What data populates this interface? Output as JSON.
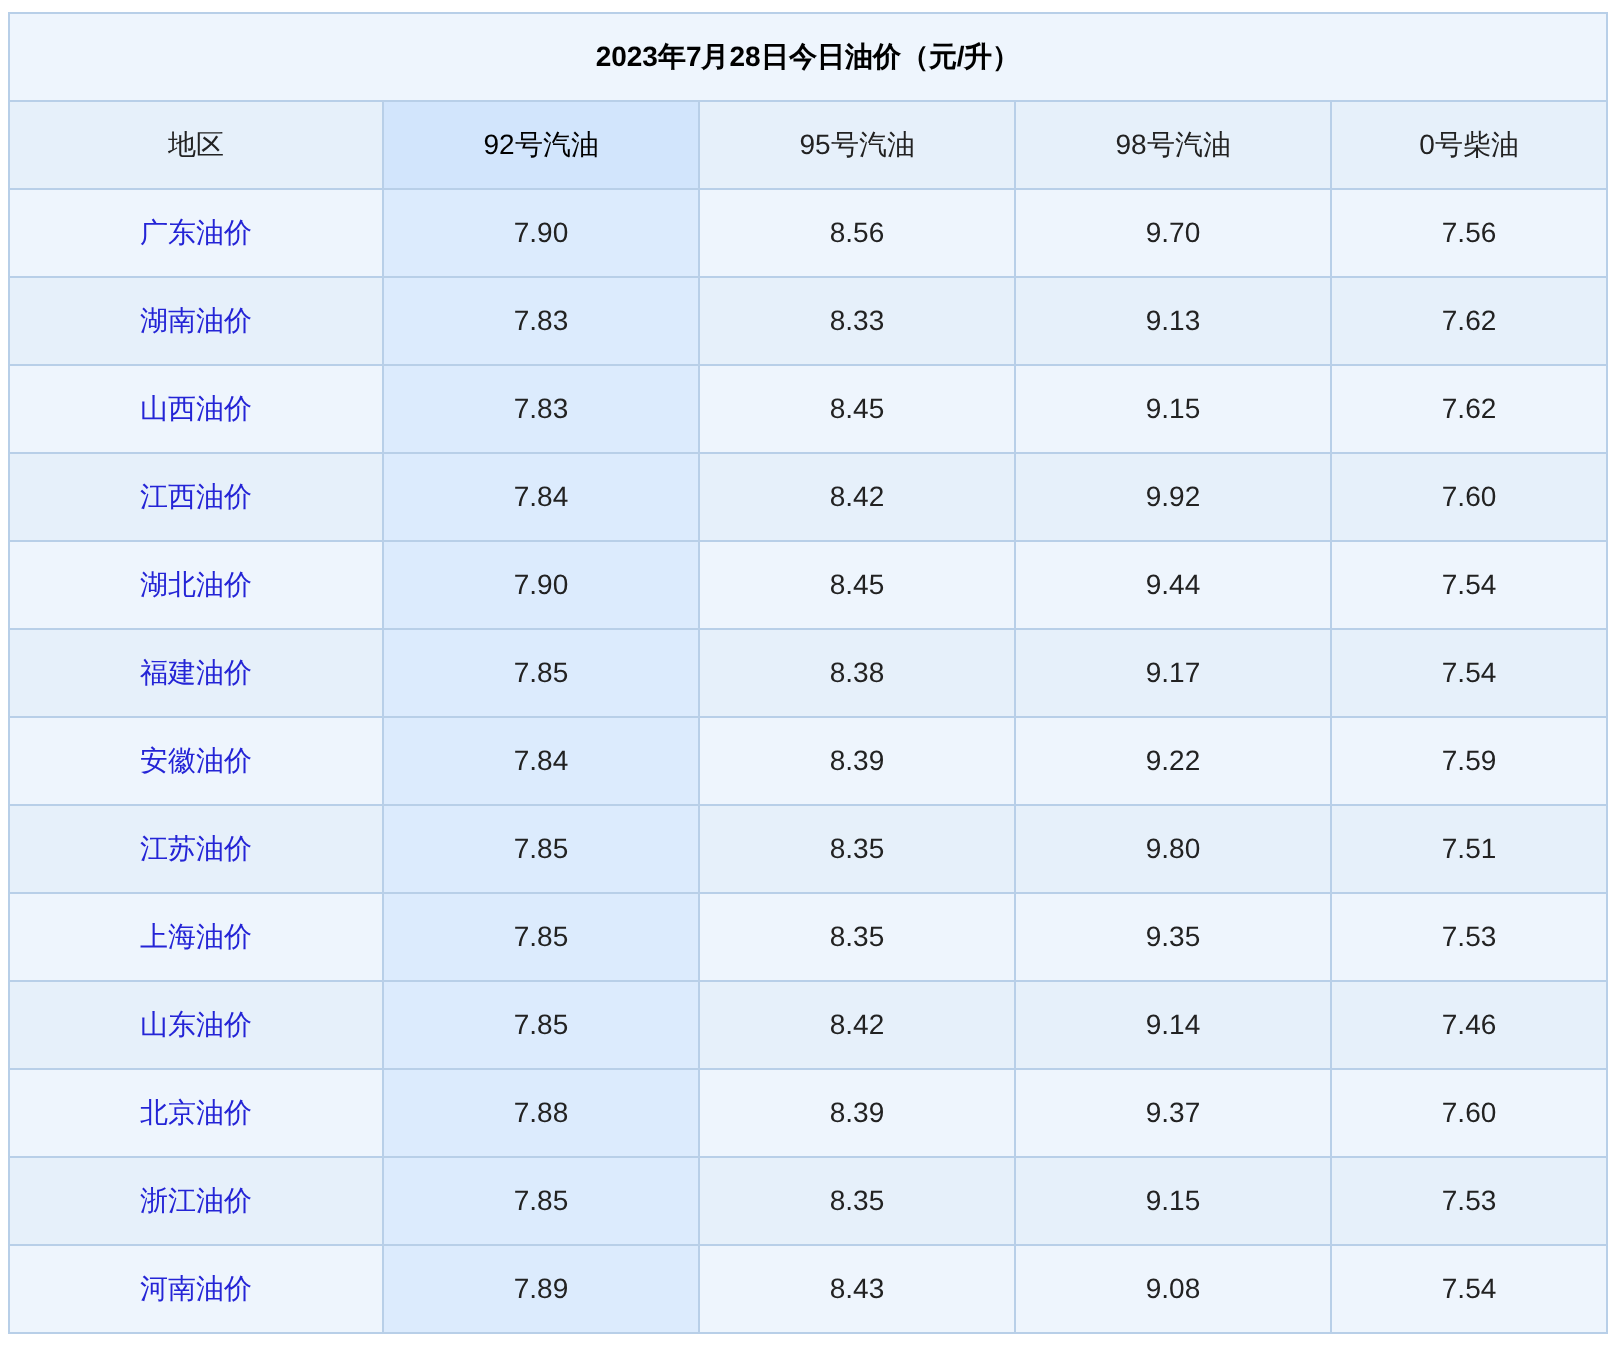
{
  "title": "2023年7月28日今日油价（元/升）",
  "columns": [
    {
      "label": "地区",
      "highlighted": false
    },
    {
      "label": "92号汽油",
      "highlighted": true
    },
    {
      "label": "95号汽油",
      "highlighted": false
    },
    {
      "label": "98号汽油",
      "highlighted": false
    },
    {
      "label": "0号柴油",
      "highlighted": false
    }
  ],
  "rows": [
    {
      "region": "广东油价",
      "prices": [
        "7.90",
        "8.56",
        "9.70",
        "7.56"
      ]
    },
    {
      "region": "湖南油价",
      "prices": [
        "7.83",
        "8.33",
        "9.13",
        "7.62"
      ]
    },
    {
      "region": "山西油价",
      "prices": [
        "7.83",
        "8.45",
        "9.15",
        "7.62"
      ]
    },
    {
      "region": "江西油价",
      "prices": [
        "7.84",
        "8.42",
        "9.92",
        "7.60"
      ]
    },
    {
      "region": "湖北油价",
      "prices": [
        "7.90",
        "8.45",
        "9.44",
        "7.54"
      ]
    },
    {
      "region": "福建油价",
      "prices": [
        "7.85",
        "8.38",
        "9.17",
        "7.54"
      ]
    },
    {
      "region": "安徽油价",
      "prices": [
        "7.84",
        "8.39",
        "9.22",
        "7.59"
      ]
    },
    {
      "region": "江苏油价",
      "prices": [
        "7.85",
        "8.35",
        "9.80",
        "7.51"
      ]
    },
    {
      "region": "上海油价",
      "prices": [
        "7.85",
        "8.35",
        "9.35",
        "7.53"
      ]
    },
    {
      "region": "山东油价",
      "prices": [
        "7.85",
        "8.42",
        "9.14",
        "7.46"
      ]
    },
    {
      "region": "北京油价",
      "prices": [
        "7.88",
        "8.39",
        "9.37",
        "7.60"
      ]
    },
    {
      "region": "浙江油价",
      "prices": [
        "7.85",
        "8.35",
        "9.15",
        "7.53"
      ]
    },
    {
      "region": "河南油价",
      "prices": [
        "7.89",
        "8.43",
        "9.08",
        "7.54"
      ]
    }
  ]
}
